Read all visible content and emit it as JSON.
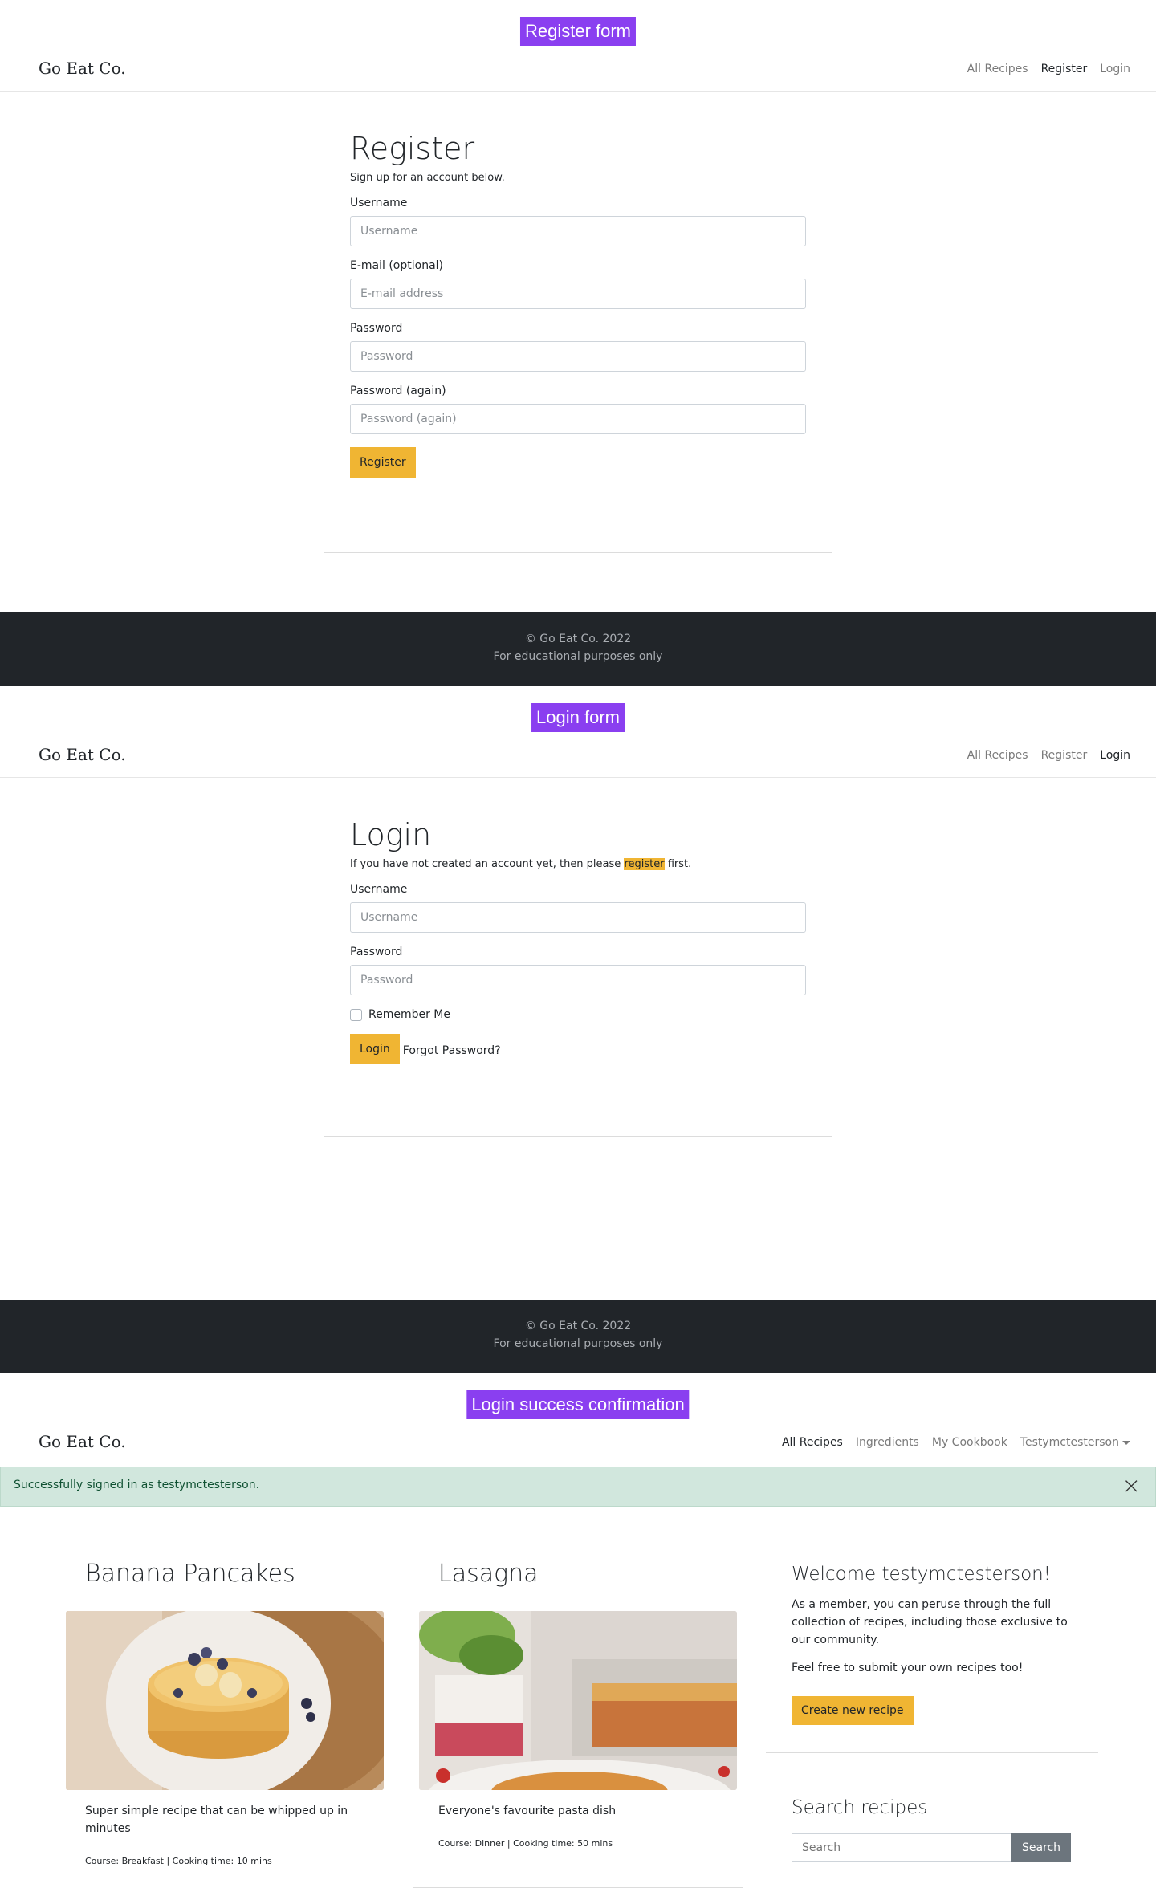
{
  "register_section": {
    "tag": "Register form",
    "brand": "Go Eat Co.",
    "nav": [
      "All Recipes",
      "Register",
      "Login"
    ],
    "title": "Register",
    "lead": "Sign up for an account below.",
    "fields": [
      {
        "label": "Username",
        "placeholder": "Username"
      },
      {
        "label": "E-mail (optional)",
        "placeholder": "E-mail address"
      },
      {
        "label": "Password",
        "placeholder": "Password"
      },
      {
        "label": "Password (again)",
        "placeholder": "Password (again)"
      }
    ],
    "button": "Register",
    "footer_line1": "© Go Eat Co. 2022",
    "footer_line2": "For educational purposes only"
  },
  "login_section": {
    "tag": "Login form",
    "brand": "Go Eat Co.",
    "nav": [
      "All Recipes",
      "Register",
      "Login"
    ],
    "title": "Login",
    "lead_before": "If you have not created an account yet, then please ",
    "lead_link": "register",
    "lead_after": " first.",
    "fields": [
      {
        "label": "Username",
        "placeholder": "Username"
      },
      {
        "label": "Password",
        "placeholder": "Password"
      }
    ],
    "remember": "Remember Me",
    "button": "Login",
    "forgot": "Forgot Password?",
    "footer_line1": "© Go Eat Co. 2022",
    "footer_line2": "For educational purposes only"
  },
  "success_section": {
    "tag": "Login success confirmation",
    "brand": "Go Eat Co.",
    "nav": [
      "All Recipes",
      "Ingredients",
      "My Cookbook",
      "Testymctesterson"
    ],
    "alert": "Successfully signed in as testymctesterson.",
    "alert_close": "×",
    "recipes": [
      {
        "title": "Banana Pancakes",
        "desc": "Super simple recipe that can be whipped up in minutes",
        "meta": "Course: Breakfast | Cooking time: 10 mins"
      },
      {
        "title": "Lasagna",
        "desc": "Everyone's favourite pasta dish",
        "meta": "Course: Dinner | Cooking time: 50 mins"
      }
    ],
    "welcome_title": "Welcome testymctesterson!",
    "welcome_p1": "As a member, you can peruse through the full collection of recipes, including those exclusive to our community.",
    "welcome_p2": "Feel free to submit your own recipes too!",
    "create_button": "Create new recipe",
    "search_title": "Search recipes",
    "search_placeholder": "Search",
    "search_button": "Search"
  }
}
